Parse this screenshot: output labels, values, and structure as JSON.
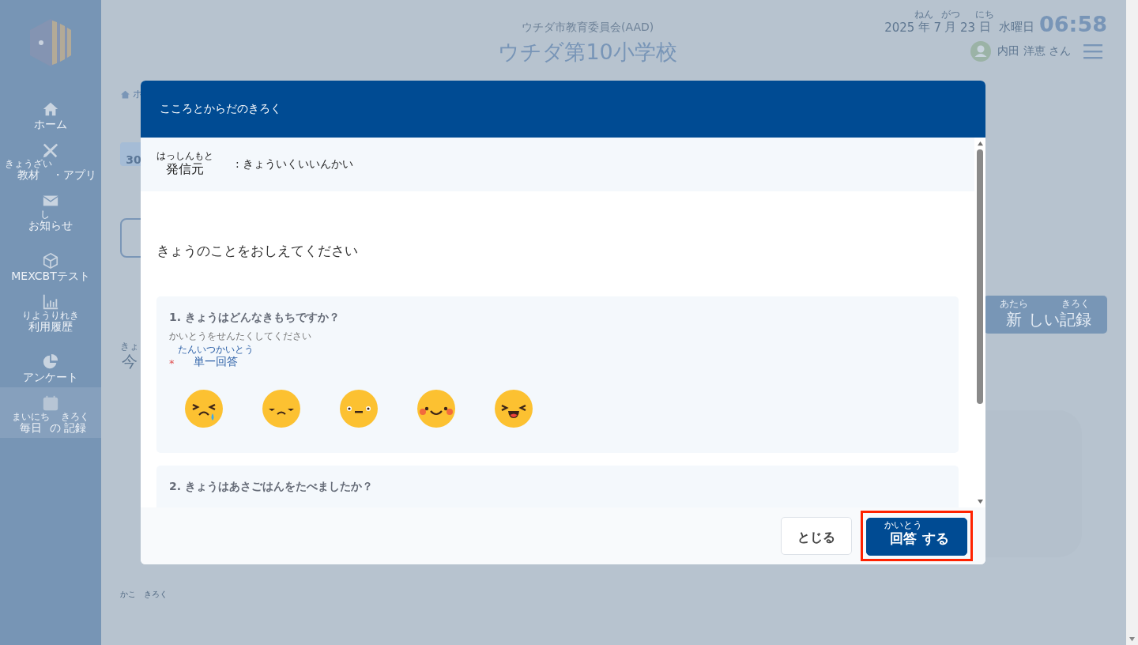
{
  "sidebar": {
    "items": [
      {
        "kind": "home",
        "label": [
          {
            "t": "ホーム"
          }
        ],
        "selected": false
      },
      {
        "kind": "tools",
        "label": [
          {
            "t": "教材",
            "r": "きょうざい"
          },
          {
            "t": "・アプリ"
          }
        ],
        "selected": false
      },
      {
        "kind": "mail",
        "label": [
          {
            "t": "お"
          },
          {
            "t": "知",
            "r": "し"
          },
          {
            "t": "らせ"
          }
        ],
        "selected": false
      },
      {
        "kind": "cube",
        "label": [
          {
            "t": "MEXCBTテスト"
          }
        ],
        "selected": false
      },
      {
        "kind": "chart",
        "label": [
          {
            "t": "利用履歴",
            "r": "りようりれき"
          }
        ],
        "selected": false
      },
      {
        "kind": "pie",
        "label": [
          {
            "t": "アンケート"
          }
        ],
        "selected": false
      },
      {
        "kind": "calendar",
        "label": [
          {
            "t": "毎日",
            "r": "まいにち"
          },
          {
            "t": "の"
          },
          {
            "t": "記録",
            "r": "きろく"
          }
        ],
        "selected": true
      }
    ]
  },
  "header": {
    "organization": "ウチダ市教育委員会(AAD)",
    "school": "ウチダ第10小学校",
    "date": [
      {
        "t": "2025"
      },
      {
        "t": "年",
        "r": "ねん"
      },
      {
        "t": "7"
      },
      {
        "t": "月",
        "r": "がつ"
      },
      {
        "t": "23"
      },
      {
        "t": "日",
        "r": "にち"
      }
    ],
    "weekday": "水曜日",
    "time": "06:58",
    "user": "内田 洋恵 さん"
  },
  "page": {
    "breadcrumb": "ホ",
    "calendar_day": "30",
    "heading": [
      {
        "t": "今",
        "r": "きょ"
      }
    ],
    "new_record_button": [
      {
        "t": "新",
        "r": "あたら"
      },
      {
        "t": "しい"
      },
      {
        "t": "記録",
        "r": "きろく"
      }
    ],
    "bottom_ruby": "かこ　きろく"
  },
  "dialog": {
    "title": "こころとからだのきろく",
    "sender_label": [
      {
        "t": "発信元",
        "r": "はっしんもと"
      }
    ],
    "sender": ": きょういくいいんかい",
    "prompt": "きょうのことをおしえてください",
    "questions": [
      {
        "title": "1. きょうはどんなきもちですか？",
        "hint": "かいとうをせんたくしてください",
        "required": true,
        "required_mark": "*",
        "answer_type": [
          {
            "t": "単一回答",
            "r": "たんいつかいとう"
          }
        ],
        "options": [
          {
            "kind": "crying"
          },
          {
            "kind": "sad"
          },
          {
            "kind": "neutral"
          },
          {
            "kind": "smile"
          },
          {
            "kind": "laugh"
          }
        ]
      },
      {
        "title": "2. きょうはあさごはんをたべましたか？"
      }
    ],
    "buttons": [
      {
        "kind": "close",
        "label": [
          {
            "t": "とじる"
          }
        ],
        "highlighted": false
      },
      {
        "kind": "submit",
        "label": [
          {
            "t": "回答",
            "r": "かいとう"
          },
          {
            "t": "する"
          }
        ],
        "highlighted": true
      }
    ]
  }
}
